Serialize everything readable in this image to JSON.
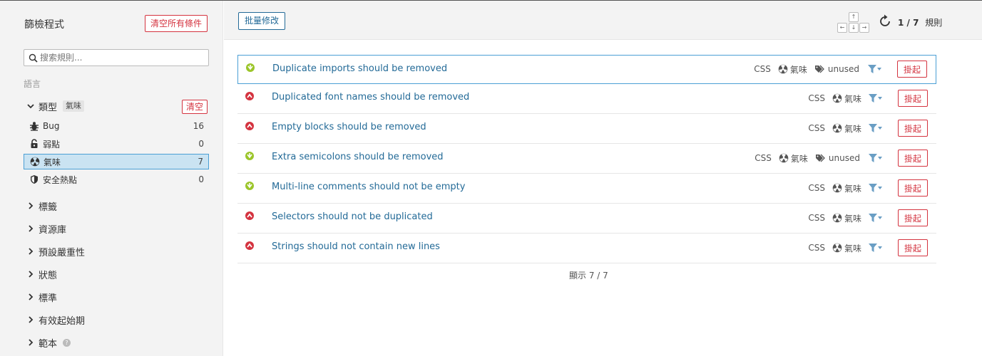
{
  "sidebar": {
    "title": "篩檢程式",
    "clear_all": "清空所有條件",
    "search_placeholder": "搜索規則...",
    "language_label": "語言",
    "type_facet": {
      "label": "類型",
      "selected_tag": "氣味",
      "clear": "清空",
      "items": [
        {
          "label": "Bug",
          "count": "16",
          "icon": "bug-icon"
        },
        {
          "label": "弱點",
          "count": "0",
          "icon": "lock-icon"
        },
        {
          "label": "氣味",
          "count": "7",
          "icon": "smell-icon",
          "selected": true
        },
        {
          "label": "安全熱點",
          "count": "0",
          "icon": "shield-icon"
        }
      ]
    },
    "facets": [
      "標籤",
      "資源庫",
      "預設嚴重性",
      "狀態",
      "標準",
      "有效起始期",
      "範本"
    ]
  },
  "toolbar": {
    "bulk_change": "批量修改",
    "count_current": "1",
    "count_sep": " / ",
    "count_total": "7",
    "count_unit": "規則"
  },
  "rules": [
    {
      "name": "Duplicate imports should be removed",
      "lang": "CSS",
      "type": "氣味",
      "tag": "unused",
      "severity": "minor",
      "action": "掛起"
    },
    {
      "name": "Duplicated font names should be removed",
      "lang": "CSS",
      "type": "氣味",
      "tag": "",
      "severity": "major",
      "action": "掛起"
    },
    {
      "name": "Empty blocks should be removed",
      "lang": "CSS",
      "type": "氣味",
      "tag": "",
      "severity": "major",
      "action": "掛起"
    },
    {
      "name": "Extra semicolons should be removed",
      "lang": "CSS",
      "type": "氣味",
      "tag": "unused",
      "severity": "minor",
      "action": "掛起"
    },
    {
      "name": "Multi-line comments should not be empty",
      "lang": "CSS",
      "type": "氣味",
      "tag": "",
      "severity": "minor",
      "action": "掛起"
    },
    {
      "name": "Selectors should not be duplicated",
      "lang": "CSS",
      "type": "氣味",
      "tag": "",
      "severity": "major",
      "action": "掛起"
    },
    {
      "name": "Strings should not contain new lines",
      "lang": "CSS",
      "type": "氣味",
      "tag": "",
      "severity": "major",
      "action": "掛起"
    }
  ],
  "footer": {
    "shown": "顯示 7 / 7"
  },
  "colors": {
    "accent_blue": "#236a97",
    "danger_red": "#d4333f",
    "minor_green": "#9bc529",
    "selected_bg": "#cae3f2"
  }
}
